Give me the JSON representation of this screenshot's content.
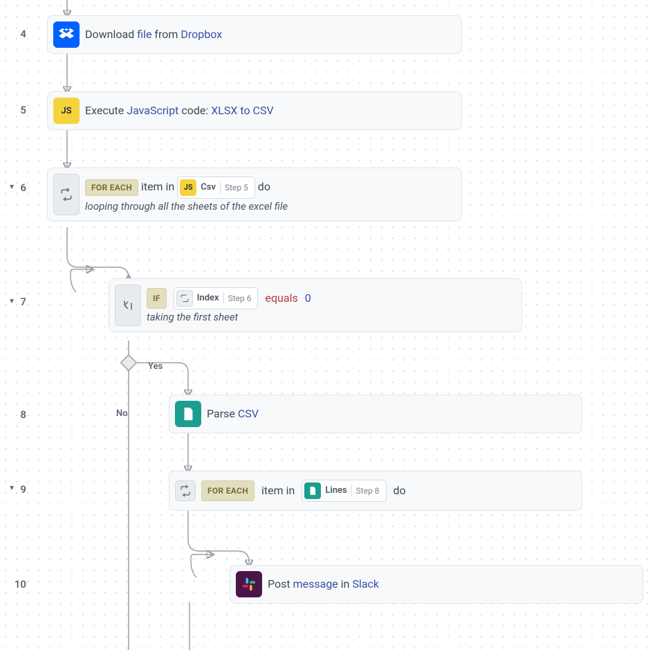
{
  "steps": {
    "s4": {
      "num": "4",
      "text_pre": "Download ",
      "link1": "file",
      "text_mid": " from ",
      "link2": "Dropbox"
    },
    "s5": {
      "num": "5",
      "text_pre": "Execute ",
      "link1": "JavaScript",
      "text_mid": " code: ",
      "link2": "XLSX to CSV",
      "icon_label": "JS"
    },
    "s6": {
      "num": "6",
      "badge": "FOR EACH",
      "text_pre": " item in ",
      "chip_icon": "JS",
      "chip_label": "Csv",
      "chip_step": "Step 5",
      "text_post": " do",
      "comment": "looping through all the sheets of the excel file"
    },
    "s7": {
      "num": "7",
      "badge": "IF",
      "chip_label": "Index",
      "chip_step": "Step 6",
      "kw": "equals",
      "val": "0",
      "comment": "taking the first sheet"
    },
    "s8": {
      "num": "8",
      "text_pre": "Parse ",
      "link1": "CSV"
    },
    "s9": {
      "num": "9",
      "badge": "FOR EACH",
      "text_pre": " item in ",
      "chip_label": "Lines",
      "chip_step": "Step 8",
      "text_post": " do"
    },
    "s10": {
      "num": "10",
      "text_pre": "Post ",
      "link1": "message",
      "text_mid": " in ",
      "link2": "Slack"
    }
  },
  "branch": {
    "yes": "Yes",
    "no": "No"
  }
}
